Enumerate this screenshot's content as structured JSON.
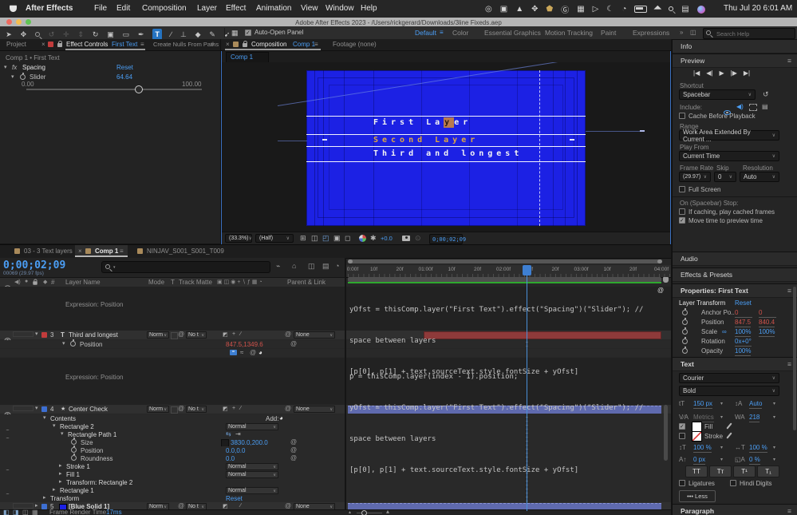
{
  "menubar": {
    "app_name": "After Effects",
    "items": [
      "File",
      "Edit",
      "Composition",
      "Layer",
      "Effect",
      "Animation",
      "View",
      "Window",
      "Help"
    ],
    "status_icons": [
      "creative-cloud",
      "screen-mirroring",
      "box-drive",
      "dropbox",
      "one-password",
      "grammarly",
      "keyboard",
      "play",
      "do-not-disturb",
      "time-machine",
      "battery",
      "wifi",
      "spotlight",
      "control-center",
      "siri"
    ],
    "clock": "Thu Jul 20 6:01 AM"
  },
  "titlebar": {
    "title": "Adobe After Effects 2023 - /Users/rickgerard/Downloads/3line Fixeds.aep"
  },
  "toolbar": {
    "tools": [
      "selection",
      "hand",
      "zoom",
      "orbit-camera",
      "pan-camera",
      "dolly-camera",
      "rotation",
      "camera",
      "rectangle",
      "pen",
      "type",
      "brush",
      "clone-stamp",
      "eraser",
      "roto-brush",
      "puppet-pin"
    ],
    "auto_open_panel": "Auto-Open Panel",
    "workspaces": [
      "Default",
      "Color",
      "Essential Graphics",
      "Motion Tracking",
      "Paint",
      "Expressions"
    ],
    "overflow": "»",
    "search_placeholder": "Search Help"
  },
  "effect_controls": {
    "tab_project": "Project",
    "tab_effect_controls": "Effect Controls",
    "tab_effect_target": "First Text",
    "tab_create_nulls": "Create Nulls From Paths",
    "breadcrumb": "Comp 1 • First Text",
    "effect_name": "Spacing",
    "reset": "Reset",
    "slider_name": "Slider",
    "slider_value": "64.64",
    "range_min": "0.00",
    "range_max": "100.00"
  },
  "viewer": {
    "tab_composition": "Composition",
    "tab_comp_name": "Comp 1",
    "tab_footage": "Footage (none)",
    "subtab": "Comp 1",
    "line1_pre": "First La",
    "line1_hl": "y",
    "line1_post": "er",
    "line2": "Second Layer",
    "line3": "Third and longest",
    "zoom": "(33.3%)",
    "resolution": "(Half)",
    "exposure": "+0.0",
    "timecode": "0;00;02;09"
  },
  "timeline": {
    "tabs": [
      "03 - 3 Text layers",
      "Comp 1",
      "NINJAV_S001_S001_T009"
    ],
    "timecode": "0;00;02;09",
    "frames_info": "00069 (29.97 fps)",
    "columns": {
      "num": "#",
      "layer_name": "Layer Name",
      "mode": "Mode",
      "t": "T",
      "track_matte": "Track Matte",
      "parent": "Parent & Link"
    },
    "mode_value": "Norm",
    "matte_value": "No t",
    "parent_value": "None",
    "normal_value": "Normal",
    "expression_label": "Expression: Position",
    "layer3_num": "3",
    "layer3_name": "Third and longest",
    "position_label": "Position",
    "layer3_position": "847.5,1349.6",
    "layer4_num": "4",
    "layer4_name": "Center Check",
    "contents_label": "Contents",
    "add_label": "Add:",
    "rectangle2": "Rectangle 2",
    "rectangle_path1": "Rectangle Path 1",
    "size_label": "Size",
    "size_value": "3830.0,200.0",
    "pos2_label": "Position",
    "pos2_value": "0.0,0.0",
    "roundness_label": "Roundness",
    "roundness_value": "0.0",
    "stroke1": "Stroke 1",
    "fill1": "Fill 1",
    "transform_rect2": "Transform: Rectangle 2",
    "rectangle1": "Rectangle 1",
    "transform_label": "Transform",
    "reset": "Reset",
    "layer5_num": "5",
    "layer5_name": "[Blue Solid 1]",
    "ruler": [
      "0:00f",
      "10f",
      "20f",
      "01:00f",
      "10f",
      "20f",
      "02:00f",
      "10f",
      "20f",
      "03:00f",
      "10f",
      "20f",
      "04:00f"
    ],
    "expr1": [
      "yOfst = thisComp.layer(\"First Text\").effect(\"Spacing\")(\"Slider\"); //",
      "space between layers",
      "[p[0], p[1] + text.sourceText.style.fontSize + yOfst]"
    ],
    "expr2": [
      "p = thisComp.layer(index - 1).position;",
      "yOfst = thisComp.layer(\"First Text\").effect(\"Spacing\")(\"Slider\"); //",
      "space between layers",
      "[p[0], p[1] + text.sourceText.style.fontSize + yOfst]"
    ],
    "render_time_label": "Frame Render Time",
    "render_time_value": "17ms"
  },
  "sidebar": {
    "info": "Info",
    "preview": {
      "title": "Preview",
      "shortcut_label": "Shortcut",
      "shortcut": "Spacebar",
      "include_label": "Include:",
      "cache": "Cache Before Playback",
      "range_label": "Range",
      "range": "Work Area Extended By Current ...",
      "play_from_label": "Play From",
      "play_from": "Current Time",
      "frame_rate_label": "Frame Rate",
      "skip_label": "Skip",
      "resolution_label": "Resolution",
      "frame_rate": "(29.97)",
      "skip": "0",
      "resolution": "Auto",
      "full_screen": "Full Screen",
      "stop_label": "On (Spacebar) Stop:",
      "cached": "If caching, play cached frames",
      "move_time": "Move time to preview time"
    },
    "audio": "Audio",
    "effects_presets": "Effects & Presets",
    "properties": {
      "title": "Properties: First Text",
      "group": "Layer Transform",
      "reset": "Reset",
      "anchor_label": "Anchor Po..",
      "anchor_x": "0",
      "anchor_y": "0",
      "position_label": "Position",
      "position_x": "847.5",
      "position_y": "840.4",
      "scale_label": "Scale",
      "scale_x": "100%",
      "scale_y": "100%",
      "rotation_label": "Rotation",
      "rotation": "0x+0°",
      "opacity_label": "Opacity",
      "opacity": "100%"
    },
    "text": {
      "title": "Text",
      "font": "Courier",
      "style": "Bold",
      "size": "150 px",
      "leading": "Auto",
      "kerning": "Metrics",
      "tracking": "218",
      "fill": "Fill",
      "stroke": "Stroke",
      "vscale": "100 %",
      "hscale": "100 %",
      "baseline": "0 px",
      "tsume": "0 %",
      "caps": [
        "TT",
        "Tт",
        "T¹",
        "T₁"
      ],
      "ligatures": "Ligatures",
      "hindi": "Hindi Digits",
      "less": "••• Less"
    },
    "paragraph": "Paragraph"
  }
}
